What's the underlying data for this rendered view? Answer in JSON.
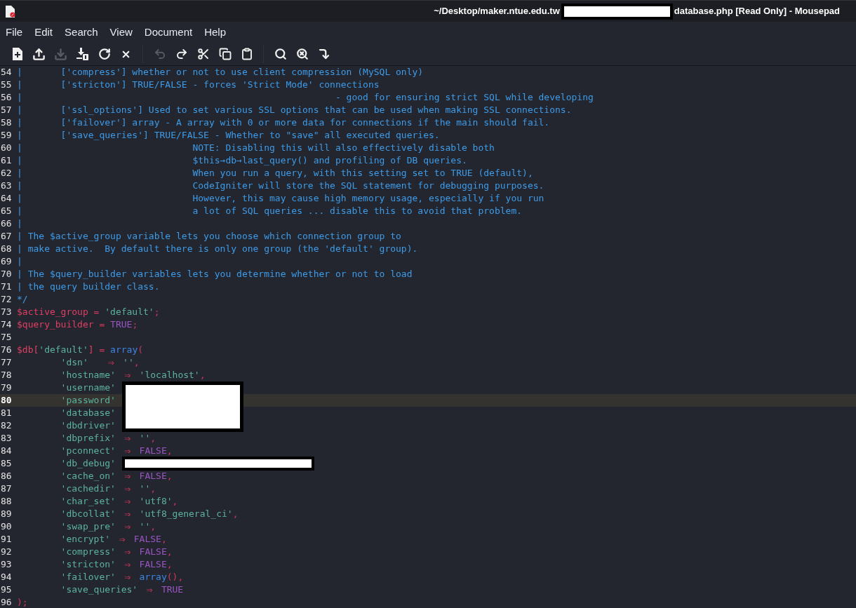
{
  "window": {
    "title_parts": [
      {
        "kind": "text",
        "text": "~/Desktop/maker.ntue.edu.tw"
      },
      {
        "kind": "redaction"
      },
      {
        "kind": "text",
        "text": "database.php [Read Only] - Mousepad"
      }
    ]
  },
  "menu": [
    "File",
    "Edit",
    "Search",
    "View",
    "Document",
    "Help"
  ],
  "toolbar": [
    {
      "disabled": false
    },
    {
      "disabled": false
    },
    {
      "disabled": true
    },
    {
      "disabled": false
    },
    {
      "disabled": false
    },
    {
      "disabled": false
    },
    {
      "disabled": true
    },
    {
      "disabled": false
    },
    {
      "disabled": false
    },
    {
      "disabled": false
    },
    {
      "disabled": false
    },
    {
      "disabled": false
    },
    {
      "disabled": false
    },
    {
      "disabled": false
    }
  ],
  "lines": [
    {
      "number": "54",
      "current": false,
      "tokens": [
        {
          "kind": "comment",
          "text": "|       ['compress'] whether or not to use client compression (MySQL only)"
        }
      ]
    },
    {
      "number": "55",
      "current": false,
      "tokens": [
        {
          "kind": "comment",
          "text": "|       ['stricton'] TRUE/FALSE - forces 'Strict Mode' connections"
        }
      ]
    },
    {
      "number": "56",
      "current": false,
      "tokens": [
        {
          "kind": "comment",
          "text": "|                                                         - good for ensuring strict SQL while developing"
        }
      ]
    },
    {
      "number": "57",
      "current": false,
      "tokens": [
        {
          "kind": "comment",
          "text": "|       ['ssl_options'] Used to set various SSL options that can be used when making SSL connections."
        }
      ]
    },
    {
      "number": "58",
      "current": false,
      "tokens": [
        {
          "kind": "comment",
          "text": "|       ['failover'] array - A array with 0 or more data for connections if the main should fail."
        }
      ]
    },
    {
      "number": "59",
      "current": false,
      "tokens": [
        {
          "kind": "comment",
          "text": "|       ['save_queries'] TRUE/FALSE - Whether to \"save\" all executed queries."
        }
      ]
    },
    {
      "number": "60",
      "current": false,
      "tokens": [
        {
          "kind": "comment",
          "text": "|                               NOTE: Disabling this will also effectively disable both"
        }
      ]
    },
    {
      "number": "61",
      "current": false,
      "tokens": [
        {
          "kind": "comment",
          "text": "|                               $this→db→last_query() and profiling of DB queries."
        }
      ]
    },
    {
      "number": "62",
      "current": false,
      "tokens": [
        {
          "kind": "comment",
          "text": "|                               When you run a query, with this setting set to TRUE (default),"
        }
      ]
    },
    {
      "number": "63",
      "current": false,
      "tokens": [
        {
          "kind": "comment",
          "text": "|                               CodeIgniter will store the SQL statement for debugging purposes."
        }
      ]
    },
    {
      "number": "64",
      "current": false,
      "tokens": [
        {
          "kind": "comment",
          "text": "|                               However, this may cause high memory usage, especially if you run"
        }
      ]
    },
    {
      "number": "65",
      "current": false,
      "tokens": [
        {
          "kind": "comment",
          "text": "|                               a lot of SQL queries ... disable this to avoid that problem."
        }
      ]
    },
    {
      "number": "66",
      "current": false,
      "tokens": [
        {
          "kind": "comment",
          "text": "|"
        }
      ]
    },
    {
      "number": "67",
      "current": false,
      "tokens": [
        {
          "kind": "comment",
          "text": "| The $active_group variable lets you choose which connection group to"
        }
      ]
    },
    {
      "number": "68",
      "current": false,
      "tokens": [
        {
          "kind": "comment",
          "text": "| make active.  By default there is only one group (the 'default' group)."
        }
      ]
    },
    {
      "number": "69",
      "current": false,
      "tokens": [
        {
          "kind": "comment",
          "text": "|"
        }
      ]
    },
    {
      "number": "70",
      "current": false,
      "tokens": [
        {
          "kind": "comment",
          "text": "| The $query_builder variables lets you determine whether or not to load"
        }
      ]
    },
    {
      "number": "71",
      "current": false,
      "tokens": [
        {
          "kind": "comment",
          "text": "| the query builder class."
        }
      ]
    },
    {
      "number": "72",
      "current": false,
      "tokens": [
        {
          "kind": "comment",
          "text": "*/"
        }
      ]
    },
    {
      "number": "73",
      "current": false,
      "tokens": [
        {
          "kind": "variable",
          "text": "$active_group"
        },
        {
          "kind": "operator",
          "text": " = "
        },
        {
          "kind": "string",
          "text": "'default'"
        },
        {
          "kind": "operator",
          "text": ";"
        }
      ]
    },
    {
      "number": "74",
      "current": false,
      "tokens": [
        {
          "kind": "variable",
          "text": "$query_builder"
        },
        {
          "kind": "operator",
          "text": " = "
        },
        {
          "kind": "constant",
          "text": "TRUE"
        },
        {
          "kind": "operator",
          "text": ";"
        }
      ]
    },
    {
      "number": "75",
      "current": false
    },
    {
      "number": "76",
      "current": false,
      "tokens": [
        {
          "kind": "variable",
          "text": "$db["
        },
        {
          "kind": "string",
          "text": "'default'"
        },
        {
          "kind": "variable",
          "text": "]"
        },
        {
          "kind": "operator",
          "text": " = "
        },
        {
          "kind": "function",
          "text": "array"
        },
        {
          "kind": "operator",
          "text": "("
        }
      ]
    },
    {
      "number": "77",
      "current": false,
      "tokens": [
        {
          "kind": "string",
          "text": "        'dsn'   "
        },
        {
          "kind": "arrow",
          "text": "⇒"
        },
        {
          "kind": "string",
          "text": " ''"
        },
        {
          "kind": "operator",
          "text": ","
        }
      ]
    },
    {
      "number": "78",
      "current": false,
      "tokens": [
        {
          "kind": "string",
          "text": "        'hostname' "
        },
        {
          "kind": "arrow",
          "text": "⇒"
        },
        {
          "kind": "string",
          "text": " 'localhost'"
        },
        {
          "kind": "operator",
          "text": ","
        }
      ]
    },
    {
      "number": "79",
      "current": false,
      "tokens": [
        {
          "kind": "string",
          "text": "        'username'"
        },
        {
          "kind": "redaction-block"
        }
      ]
    },
    {
      "number": "80",
      "current": true,
      "tokens": [
        {
          "kind": "string",
          "text": "        'password'"
        }
      ]
    },
    {
      "number": "81",
      "current": false,
      "tokens": [
        {
          "kind": "string",
          "text": "        'database'"
        }
      ]
    },
    {
      "number": "82",
      "current": false,
      "tokens": [
        {
          "kind": "string",
          "text": "        'dbdriver'"
        }
      ]
    },
    {
      "number": "83",
      "current": false,
      "tokens": [
        {
          "kind": "string",
          "text": "        'dbprefix' "
        },
        {
          "kind": "arrow",
          "text": "⇒"
        },
        {
          "kind": "string",
          "text": " ''"
        },
        {
          "kind": "operator",
          "text": ","
        }
      ]
    },
    {
      "number": "84",
      "current": false,
      "tokens": [
        {
          "kind": "string",
          "text": "        'pconnect' "
        },
        {
          "kind": "arrow",
          "text": "⇒"
        },
        {
          "kind": "constant",
          "text": " FALSE"
        },
        {
          "kind": "operator",
          "text": ","
        }
      ]
    },
    {
      "number": "85",
      "current": false,
      "tokens": [
        {
          "kind": "string",
          "text": "        'db_debug'"
        },
        {
          "kind": "redaction-bar"
        }
      ]
    },
    {
      "number": "86",
      "current": false,
      "tokens": [
        {
          "kind": "string",
          "text": "        'cache_on' "
        },
        {
          "kind": "arrow",
          "text": "⇒"
        },
        {
          "kind": "constant",
          "text": " FALSE"
        },
        {
          "kind": "operator",
          "text": ","
        }
      ]
    },
    {
      "number": "87",
      "current": false,
      "tokens": [
        {
          "kind": "string",
          "text": "        'cachedir' "
        },
        {
          "kind": "arrow",
          "text": "⇒"
        },
        {
          "kind": "string",
          "text": " ''"
        },
        {
          "kind": "operator",
          "text": ","
        }
      ]
    },
    {
      "number": "88",
      "current": false,
      "tokens": [
        {
          "kind": "string",
          "text": "        'char_set' "
        },
        {
          "kind": "arrow",
          "text": "⇒"
        },
        {
          "kind": "string",
          "text": " 'utf8'"
        },
        {
          "kind": "operator",
          "text": ","
        }
      ]
    },
    {
      "number": "89",
      "current": false,
      "tokens": [
        {
          "kind": "string",
          "text": "        'dbcollat' "
        },
        {
          "kind": "arrow",
          "text": "⇒"
        },
        {
          "kind": "string",
          "text": " 'utf8_general_ci'"
        },
        {
          "kind": "operator",
          "text": ","
        }
      ]
    },
    {
      "number": "90",
      "current": false,
      "tokens": [
        {
          "kind": "string",
          "text": "        'swap_pre' "
        },
        {
          "kind": "arrow",
          "text": "⇒"
        },
        {
          "kind": "string",
          "text": " ''"
        },
        {
          "kind": "operator",
          "text": ","
        }
      ]
    },
    {
      "number": "91",
      "current": false,
      "tokens": [
        {
          "kind": "string",
          "text": "        'encrypt' "
        },
        {
          "kind": "arrow",
          "text": "⇒"
        },
        {
          "kind": "constant",
          "text": " FALSE"
        },
        {
          "kind": "operator",
          "text": ","
        }
      ]
    },
    {
      "number": "92",
      "current": false,
      "tokens": [
        {
          "kind": "string",
          "text": "        'compress' "
        },
        {
          "kind": "arrow",
          "text": "⇒"
        },
        {
          "kind": "constant",
          "text": " FALSE"
        },
        {
          "kind": "operator",
          "text": ","
        }
      ]
    },
    {
      "number": "93",
      "current": false,
      "tokens": [
        {
          "kind": "string",
          "text": "        'stricton' "
        },
        {
          "kind": "arrow",
          "text": "⇒"
        },
        {
          "kind": "constant",
          "text": " FALSE"
        },
        {
          "kind": "operator",
          "text": ","
        }
      ]
    },
    {
      "number": "94",
      "current": false,
      "tokens": [
        {
          "kind": "string",
          "text": "        'failover' "
        },
        {
          "kind": "arrow",
          "text": "⇒"
        },
        {
          "kind": "function",
          "text": " array"
        },
        {
          "kind": "operator",
          "text": "(),"
        }
      ]
    },
    {
      "number": "95",
      "current": false,
      "tokens": [
        {
          "kind": "string",
          "text": "        'save_queries' "
        },
        {
          "kind": "arrow",
          "text": "⇒"
        },
        {
          "kind": "constant",
          "text": " TRUE"
        }
      ]
    },
    {
      "number": "96",
      "current": false,
      "tokens": [
        {
          "kind": "operator",
          "text": ");"
        }
      ]
    }
  ]
}
